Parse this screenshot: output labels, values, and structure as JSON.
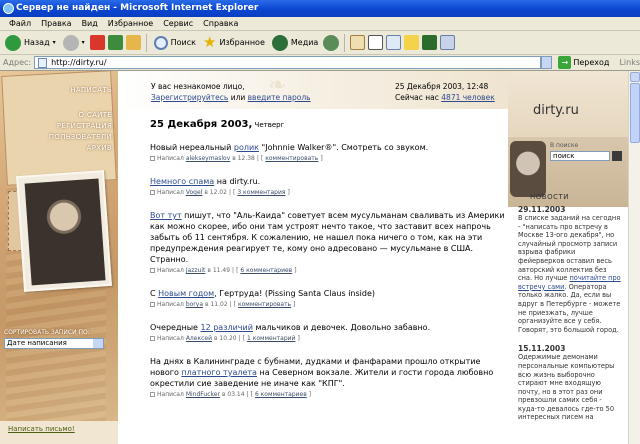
{
  "window": {
    "title": "Сервер не найден - Microsoft Internet Explorer"
  },
  "menu": [
    "Файл",
    "Правка",
    "Вид",
    "Избранное",
    "Сервис",
    "Справка"
  ],
  "toolbar": {
    "back": "Назад",
    "search": "Поиск",
    "favorites": "Избранное",
    "media": "Медиа"
  },
  "address": {
    "label": "Адрес:",
    "url": "http://dirty.ru/",
    "go": "Переход",
    "links": "Links"
  },
  "site": {
    "nav": {
      "write": "НАПИСАТЬ",
      "items": [
        "О САЙТЕ",
        "РЕГИСТРАЦИЯ",
        "ПОЛЬЗОВАТЕЛИ",
        "АРХИВ"
      ]
    },
    "sort_label": "СОРТИРОВАТЬ ЗАПИСИ ПО:",
    "sort_value": "Дате написания",
    "write_letter": "Написать письмо!",
    "header": {
      "greeting": "У вас незнакомое лицо,",
      "register": "Зарегистрируйтесь",
      "or": " или ",
      "login": "введите пароль",
      "date": "25 Декабря 2003, 12:48",
      "online_prefix": "Сейчас нас ",
      "online_count": "4871 человек"
    },
    "date_heading": {
      "date": "25 Декабря 2003,",
      "weekday": " Четверг"
    },
    "posts": [
      {
        "pre": "Новый нереальный ",
        "link": "ролик",
        "post": " \"Johnnie Walker®\". Смотреть со звуком.",
        "author": "alekseymaslov",
        "time": "в 12.38",
        "comments": "комментировать"
      },
      {
        "pre": "",
        "link": "Немного спама",
        "post": " на dirty.ru.",
        "author": "Vogel",
        "time": "в 12.02",
        "comments": "3 комментария"
      },
      {
        "pre": "",
        "link": "Вот тут",
        "post": " пишут, что \"Аль-Каида\" советует всем мусульманам сваливать из Америки как можно скорее, ибо они там устроят нечто такое, что заставит всех напрочь забыть об 11 сентября. К сожалению, не нашел пока ничего о том, как на эти предупреждения реагирует те, кому оно адресовано — мусульмане в США. Странно.",
        "author": "Jazzuit",
        "time": "в 11.49",
        "comments": "6 комментариев"
      },
      {
        "pre": "С ",
        "link": "Новым годом",
        "post": ", Гертруда! (Pissing Santa Claus inside)",
        "author": "borya",
        "time": "в 11.02",
        "comments": "комментировать"
      },
      {
        "pre": "Очередные ",
        "link": "12 различий",
        "post": " мальчиков и девочек. Довольно забавно.",
        "author": "Алексей",
        "time": "в 10.20",
        "comments": "1 комментарий"
      },
      {
        "pre": "На днях в Калининграде с бубнами, дудками и фанфарами прошло открытие нового ",
        "link": "платного туалета",
        "post": " на Северном вокзале. Жители и гости города любовно окрестили сие заведение не иначе как \"КПГ\".",
        "author": "MindFucker",
        "time": "в 03.14",
        "comments": "6 комментариев"
      }
    ],
    "written_label": "Написал",
    "right": {
      "logo": "dirty.ru",
      "search_label": "В поиске",
      "search_value": "поиск",
      "news_title": "НОВОСТИ",
      "news": [
        {
          "date": "29.11.2003",
          "pre": "В списке заданий на сегодня - \"написать про встречу в Москве 13-ого декабря\", но случайный просмотр записи взрыва фабрики фейерверков оставил весь авторский коллектив без сна. Но лучше ",
          "link": "почитайте про встречу сами",
          "post": ". Оператора только жалко. Да, если вы вдруг в Петербурге - можете не приезжать, лучше организуйте все у себя. Говорят, это большой город."
        },
        {
          "date": "15.11.2003",
          "pre": "Одержимые демонами персональные компьютеры всю жизнь выборочно стирают мне входящую почту, но в этот раз они превзошли самих себя - куда-то девалось где-то 50 интересных писем на",
          "link": "",
          "post": ""
        }
      ]
    }
  }
}
